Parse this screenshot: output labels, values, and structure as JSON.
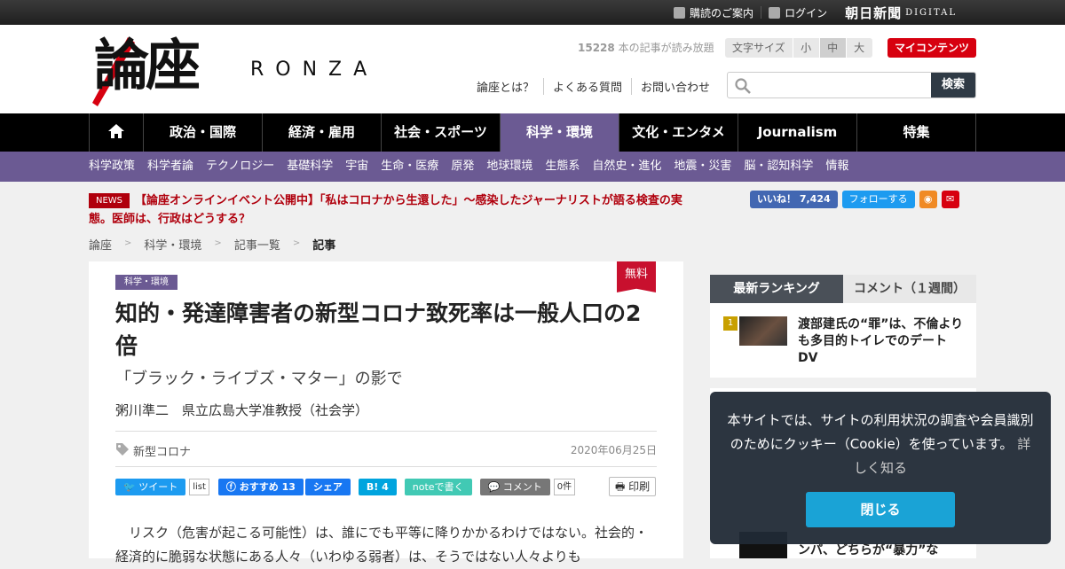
{
  "topbar": {
    "subscribe": "購読のご案内",
    "login": "ログイン",
    "asahi_logo": "朝日新聞",
    "asahi_sub": "DIGITAL"
  },
  "header": {
    "logo_jp": "論座",
    "logo_en": "RONZA",
    "article_count_num": "15228",
    "article_count_text": " 本の記事が読み放題",
    "fontsize_label": "文字サイズ",
    "fontsize_small": "小",
    "fontsize_medium": "中",
    "fontsize_large": "大",
    "mycontents": "マイコンテンツ",
    "links": [
      "論座とは？",
      "よくある質問",
      "お問い合わせ"
    ],
    "search_placeholder": "",
    "search_button": "検索"
  },
  "nav": {
    "items": [
      "政治・国際",
      "経済・雇用",
      "社会・スポーツ",
      "科学・環境",
      "文化・エンタメ",
      "Journalism",
      "特集"
    ]
  },
  "subnav": {
    "items": [
      "科学政策",
      "科学者論",
      "テクノロジー",
      "基礎科学",
      "宇宙",
      "生命・医療",
      "原発",
      "地球環境",
      "生態系",
      "自然史・進化",
      "地震・災害",
      "脳・認知科学",
      "情報"
    ]
  },
  "news": {
    "badge": "NEWS",
    "text": "【論座オンラインイベント公開中】「私はコロナから生還した」～感染したジャーナリストが語る検査の実態。医師は、行政はどうする？"
  },
  "social_top": {
    "fb_like": "いいね！ 7,424",
    "tw_follow": "フォローする"
  },
  "breadcrumb": [
    "論座",
    "科学・環境",
    "記事一覧",
    "記事"
  ],
  "article": {
    "free_badge": "無料",
    "category": "科学・環境",
    "title": "知的・発達障害者の新型コロナ致死率は一般人口の2倍",
    "subtitle": "「ブラック・ライブズ・マター」の影で",
    "author": "粥川準二　県立広島大学准教授（社会学）",
    "tag": "新型コロナ",
    "date": "2020年06月25日",
    "share": {
      "tweet": "ツイート",
      "tweet_count": "list",
      "fb_recommend": "おすすめ 13",
      "fb_share": "シェア",
      "hatena": "B! 4",
      "note": "noteで書く",
      "comment": "コメント",
      "comment_count": "0件",
      "print": "印刷"
    },
    "body": "リスク（危害が起こる可能性）は、誰にでも平等に降りかかるわけではない。社会的・経済的に脆弱な状態にある人々（いわゆる弱者）は、そうではない人々よりも"
  },
  "sidebar": {
    "tab_ranking": "最新ランキング",
    "tab_comments": "コメント（１週間）",
    "rank1_num": "1",
    "rank1_title": "渡部建氏の“罪”は、不倫よりも多目的トイレでのデートDV",
    "rank_bottom_text": "ンパ、どちらが“暴力”な"
  },
  "cookie": {
    "text": "本サイトでは、サイトの利用状況の調査や会員識別のためにクッキー（Cookie）を使っています。",
    "link": "詳しく知る",
    "close": "閉じる"
  },
  "colors": {
    "nav_active": "#6b5a93",
    "subnav_bg": "#6b5a93",
    "news_red": "#b0000d",
    "mycontents_red": "#d7000f",
    "cookie_button": "#1aa3d6"
  }
}
